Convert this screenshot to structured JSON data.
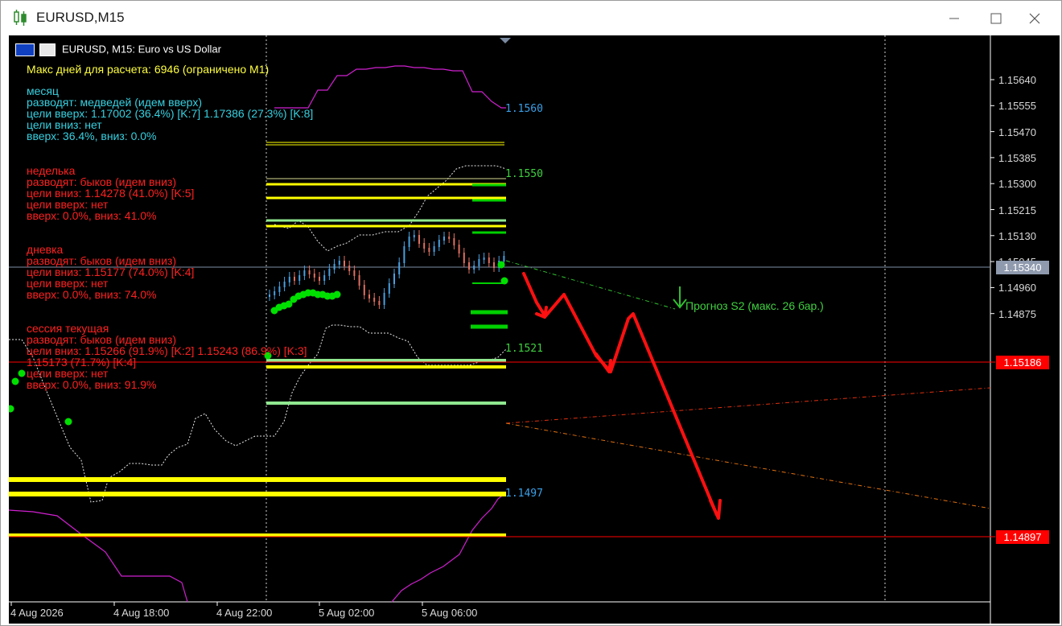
{
  "window": {
    "title": "EURUSD,M15",
    "minimize_icon": "minimize-icon",
    "maximize_icon": "maximize-icon",
    "close_icon": "close-icon"
  },
  "chart": {
    "header": "EURUSD, M15:  Euro vs US Dollar",
    "max_days": "Макс дней для расчета: 6946 (ограничено M1)",
    "blocks": [
      {
        "color": "#36d0e0",
        "lines": [
          "месяц",
          "разводят: медведей (идем вверх)",
          "цели вверх: 1.17002 (36.4%) [K:7] 1.17386 (27.3%) [K:8]",
          "цели вниз: нет",
          "вверх: 36.4%, вниз: 0.0%"
        ]
      },
      {
        "color": "#ff2020",
        "lines": [
          "неделька",
          "разводят: быков (идем вниз)",
          "цели вниз: 1.14278 (41.0%) [K:5]",
          "цели вверх: нет",
          "вверх: 0.0%, вниз: 41.0%"
        ]
      },
      {
        "color": "#ff2020",
        "lines": [
          "дневка",
          "разводят: быков (идем вниз)",
          "цели вниз: 1.15177 (74.0%) [K:4]",
          "цели вверх: нет",
          "вверх: 0.0%, вниз: 74.0%"
        ]
      },
      {
        "color": "#ff2020",
        "lines": [
          "сессия текущая",
          "разводят: быков (идем вниз)",
          "цели вниз: 1.15266 (91.9%) [K:2] 1.15243 (86.9%) [K:3]",
          "1.15173 (71.7%) [K:4]",
          "цели вверх: нет",
          "вверх: 0.0%, вниз: 91.9%"
        ]
      }
    ],
    "forecast_label": "Прогноз S2 (макс. 26 бар.)",
    "level_labels": [
      {
        "text": "1.1560",
        "color": "#3aa0e8"
      },
      {
        "text": "1.1550",
        "color": "#3fd040"
      },
      {
        "text": "1.1521",
        "color": "#3fd040"
      },
      {
        "text": "1.1497",
        "color": "#3aa0e8"
      }
    ],
    "price_axis": [
      "1.15640",
      "1.15555",
      "1.15470",
      "1.15385",
      "1.15300",
      "1.15215",
      "1.15130",
      "1.15045",
      "1.14960",
      "1.14875"
    ],
    "current_price": "1.15340",
    "red_levels": [
      "1.15186",
      "1.14897"
    ],
    "time_axis": [
      "4 Aug 2026",
      "4 Aug 18:00",
      "4 Aug 22:00",
      "5 Aug 02:00",
      "5 Aug 06:00"
    ],
    "colors": {
      "background": "#000000",
      "yellow": "#ffff00",
      "green": "#00e000",
      "magenta": "#d020d0",
      "red": "#ff0000",
      "light_green": "#90e890"
    }
  }
}
